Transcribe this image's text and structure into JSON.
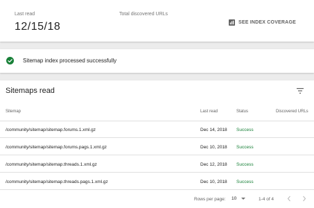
{
  "summary": {
    "last_read_label": "Last read",
    "last_read_value": "12/15/18",
    "total_urls_label": "Total discovered URLs",
    "coverage_button": "SEE INDEX COVERAGE"
  },
  "status": {
    "message": "Sitemap index processed successfully",
    "color": "#188038"
  },
  "sitemaps": {
    "title": "Sitemaps read",
    "columns": {
      "sitemap": "Sitemap",
      "last_read": "Last read",
      "status": "Status",
      "discovered": "Discovered URLs"
    },
    "rows": [
      {
        "sitemap": "/community/sitemap/sitemap.forums.1.xml.gz",
        "last_read": "Dec 14, 2018",
        "status": "Success"
      },
      {
        "sitemap": "/community/sitemap/sitemap.forums.pags.1.xml.gz",
        "last_read": "Dec 10, 2018",
        "status": "Success"
      },
      {
        "sitemap": "/community/sitemap/sitemap.threads.1.xml.gz",
        "last_read": "Dec 12, 2018",
        "status": "Success"
      },
      {
        "sitemap": "/community/sitemap/sitemap.threads.pags.1.xml.gz",
        "last_read": "Dec 10, 2018",
        "status": "Success"
      }
    ],
    "pagination": {
      "rows_per_page_label": "Rows per page:",
      "rows_per_page_value": "10",
      "range": "1-4 of 4"
    },
    "success_color": "#188038"
  }
}
